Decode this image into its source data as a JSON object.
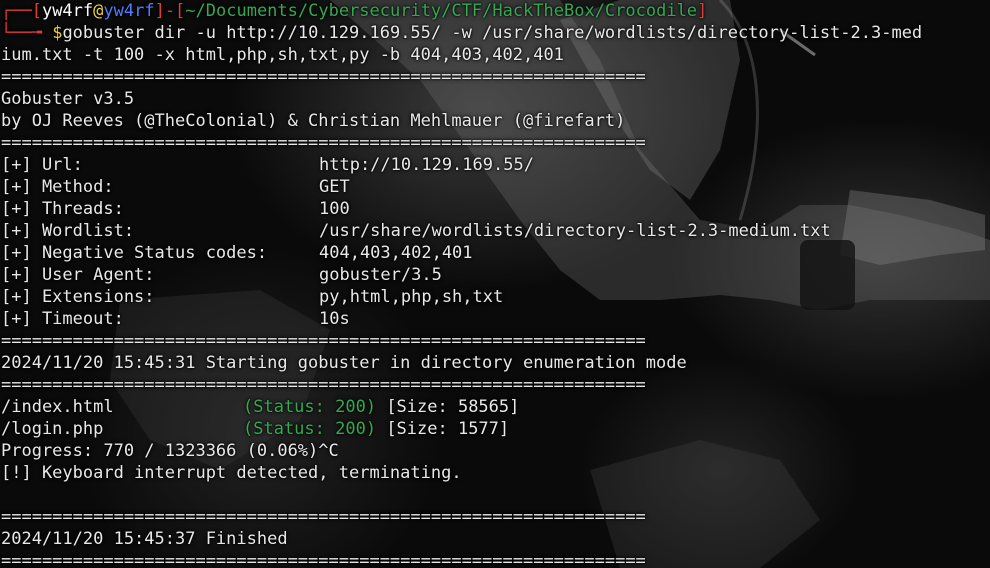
{
  "prompt": {
    "corner_top": "┌──[",
    "user": "yw4rf",
    "at": "@",
    "host": "yw4rf",
    "sep": "]-[",
    "path": "~/Documents/Cybersecurity/CTF/HackTheBox/Crocodile",
    "close": "]",
    "corner_bottom": "└──╼ ",
    "dollar": "$",
    "command_line1": "gobuster dir -u http://10.129.169.55/ -w /usr/share/wordlists/directory-list-2.3-med",
    "command_line2": "ium.txt -t 100 -x html,php,sh,txt,py -b 404,403,402,401"
  },
  "output": {
    "separator": "===============================================================",
    "banner_title": "Gobuster v3.5",
    "banner_author": "by OJ Reeves (@TheColonial) & Christian Mehlmauer (@firefart)",
    "config": [
      {
        "label": "[+] Url:",
        "value": "http://10.129.169.55/"
      },
      {
        "label": "[+] Method:",
        "value": "GET"
      },
      {
        "label": "[+] Threads:",
        "value": "100"
      },
      {
        "label": "[+] Wordlist:",
        "value": "/usr/share/wordlists/directory-list-2.3-medium.txt"
      },
      {
        "label": "[+] Negative Status codes:",
        "value": "404,403,402,401"
      },
      {
        "label": "[+] User Agent:",
        "value": "gobuster/3.5"
      },
      {
        "label": "[+] Extensions:",
        "value": "py,html,php,sh,txt"
      },
      {
        "label": "[+] Timeout:",
        "value": "10s"
      }
    ],
    "start_line": "2024/11/20 15:45:31 Starting gobuster in directory enumeration mode",
    "results": [
      {
        "path": "/index.html",
        "status": "(Status: 200)",
        "size": "[Size: 58565]"
      },
      {
        "path": "/login.php",
        "status": "(Status: 200)",
        "size": "[Size: 1577]"
      }
    ],
    "progress": "Progress: 770 / 1323366 (0.06%)^C",
    "interrupt": "[!] Keyboard interrupt detected, terminating.",
    "finished_line": "2024/11/20 15:45:37 Finished"
  },
  "colors": {
    "prompt_red": "#e03a3a",
    "prompt_blue": "#4f7cff",
    "dollar_yellow": "#f2d13b",
    "status_green": "#34a853",
    "text": "#e8e8e8"
  }
}
